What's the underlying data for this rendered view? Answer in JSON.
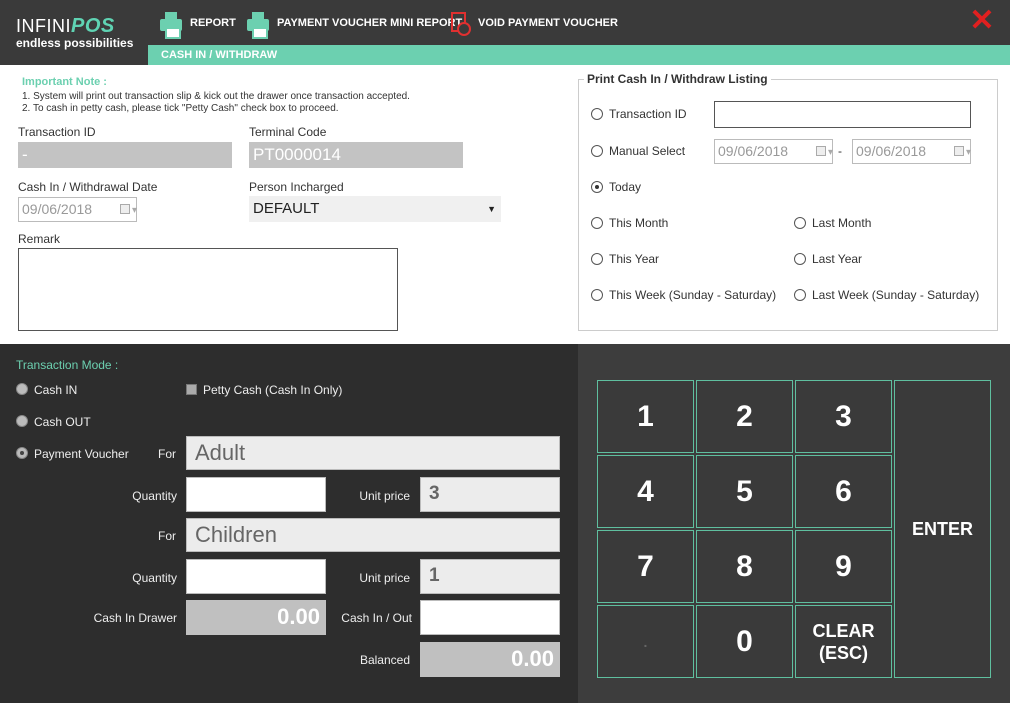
{
  "logo": {
    "brand": "INFINI",
    "brand_accent": "POS",
    "tagline": "endless possibilities"
  },
  "toolbar": {
    "report_label": "REPORT",
    "mini_report_label": "PAYMENT VOUCHER MINI REPORT",
    "void_label": "VOID PAYMENT VOUCHER",
    "close_glyph": "✕"
  },
  "subbar": {
    "title": "CASH IN / WITHDRAW"
  },
  "note": {
    "title": "Important Note :",
    "line1": "1. System will print out transaction slip & kick out the drawer once transaction accepted.",
    "line2": "2. To cash in petty cash, please tick \"Petty Cash\" check box to proceed."
  },
  "form": {
    "transaction_id_label": "Transaction ID",
    "transaction_id_value": "-",
    "terminal_code_label": "Terminal Code",
    "terminal_code_value": "PT0000014",
    "date_label": "Cash In / Withdrawal Date",
    "date_value": "09/06/2018",
    "person_label": "Person Incharged",
    "person_value": "DEFAULT",
    "remark_label": "Remark"
  },
  "listing": {
    "legend": "Print Cash In / Withdraw Listing",
    "transaction_id": "Transaction ID",
    "manual_select": "Manual Select",
    "date_from": "09/06/2018",
    "date_sep": "-",
    "date_to": "09/06/2018",
    "today": "Today",
    "this_month": "This Month",
    "last_month": "Last Month",
    "this_year": "This Year",
    "last_year": "Last Year",
    "this_week": "This Week (Sunday - Saturday)",
    "last_week": "Last Week (Sunday - Saturday)",
    "selected": "today"
  },
  "mode": {
    "title": "Transaction Mode :",
    "cash_in": "Cash IN",
    "cash_out": "Cash OUT",
    "payment_voucher": "Payment Voucher",
    "petty_cash": "Petty Cash (Cash In Only)",
    "selected": "payment_voucher",
    "for_label": "For",
    "adult": "Adult",
    "children": "Children",
    "quantity_label": "Quantity",
    "unit_price_label": "Unit price",
    "adult_price": "3",
    "children_price": "1",
    "cash_in_drawer_label": "Cash In Drawer",
    "cash_in_drawer_value": "0.00",
    "cash_in_out_label": "Cash In / Out",
    "balanced_label": "Balanced",
    "balanced_value": "0.00"
  },
  "keypad": {
    "k1": "1",
    "k2": "2",
    "k3": "3",
    "k4": "4",
    "k5": "5",
    "k6": "6",
    "k7": "7",
    "k8": "8",
    "k9": "9",
    "kdot": ".",
    "k0": "0",
    "clear_line1": "CLEAR",
    "clear_line2": "(ESC)",
    "enter": "ENTER"
  },
  "colors": {
    "accent": "#6cd0b0",
    "dark_panel": "#2d2d2d",
    "close": "#e02020"
  }
}
